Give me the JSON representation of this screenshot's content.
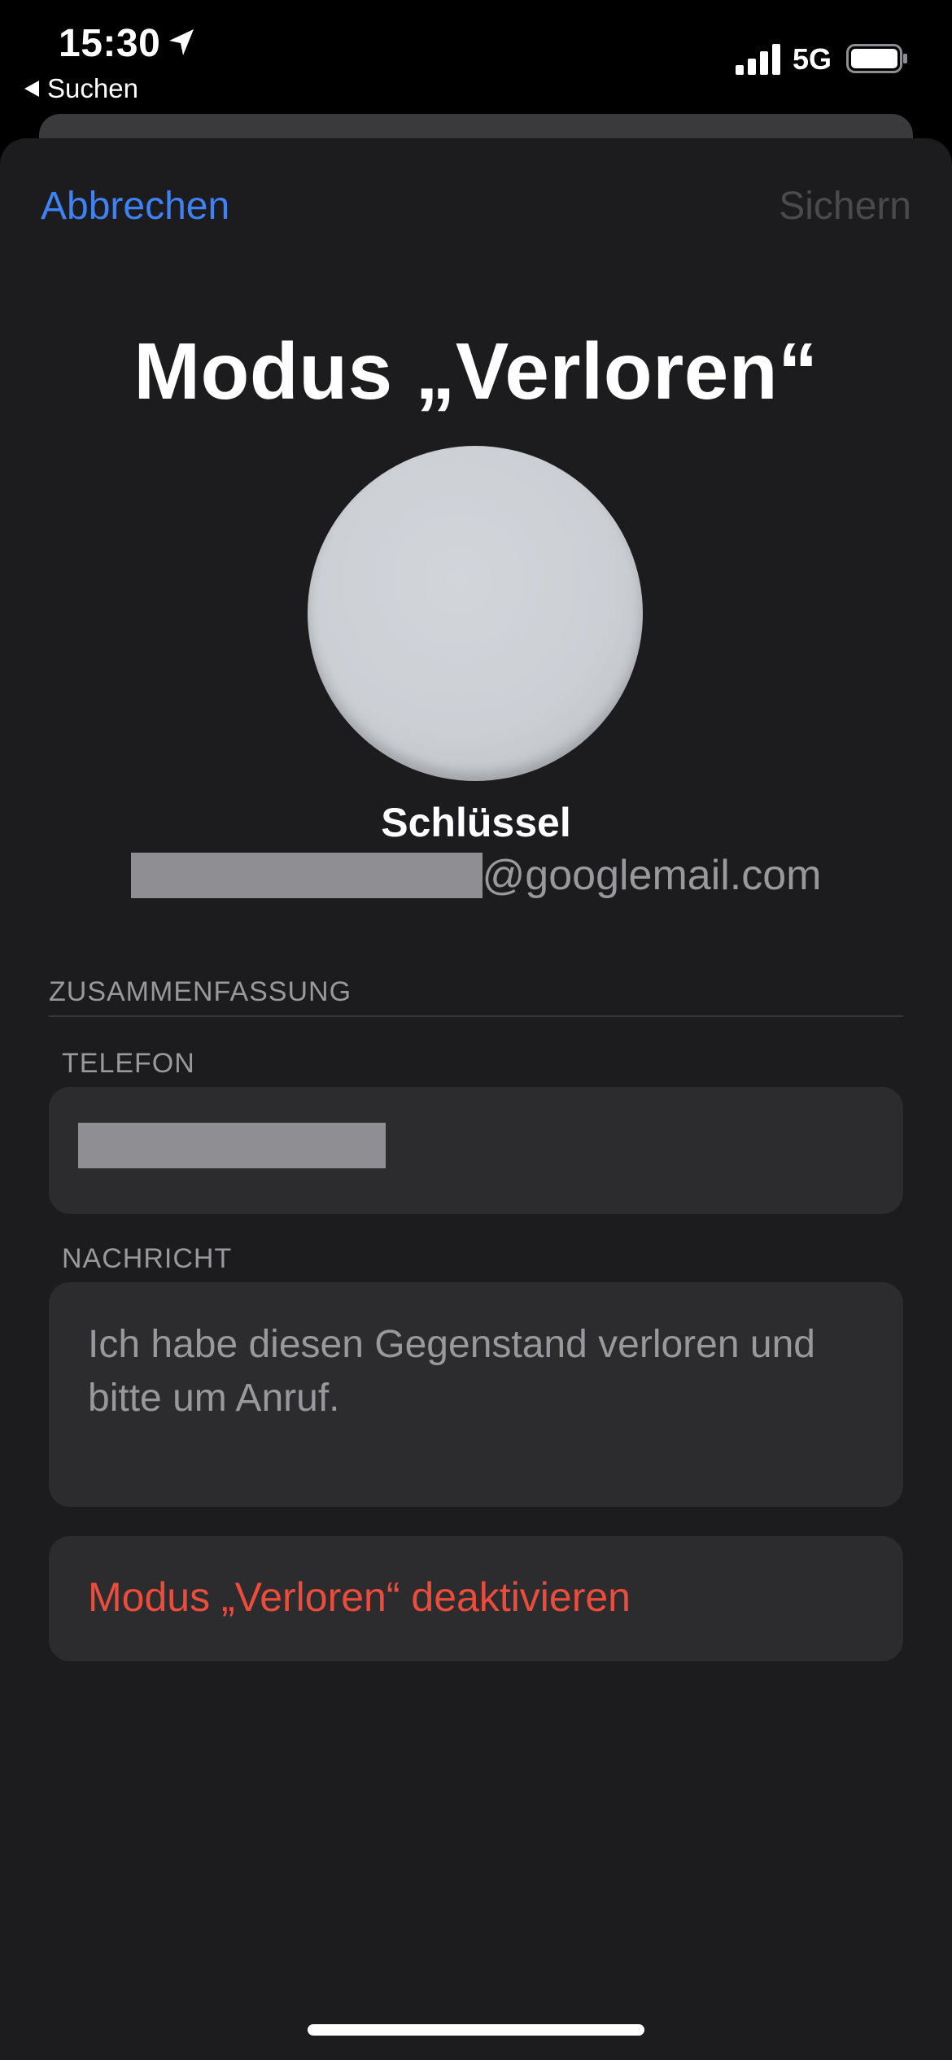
{
  "status_bar": {
    "time": "15:30",
    "back_label": "Suchen",
    "network": "5G",
    "location_icon": "location-arrow-icon",
    "signal_icon": "cellular-signal-icon",
    "battery_icon": "battery-icon"
  },
  "nav": {
    "cancel_label": "Abbrechen",
    "save_label": "Sichern"
  },
  "header": {
    "title": "Modus „Verloren“",
    "item_name": "Schlüssel",
    "email_domain": "@googlemail.com"
  },
  "summary": {
    "section_title": "ZUSAMMENFASSUNG",
    "phone_label": "TELEFON",
    "message_label": "NACHRICHT",
    "message_text": "Ich habe diesen Gegenstand verloren und bitte um Anruf."
  },
  "actions": {
    "deactivate_label": "Modus „Verloren“ deaktivieren"
  },
  "colors": {
    "accent_blue": "#3f82f5",
    "destructive_red": "#eb4d3d",
    "sheet_background": "#1c1c1e",
    "field_background": "#2c2c2e",
    "secondary_text": "#98989d"
  }
}
